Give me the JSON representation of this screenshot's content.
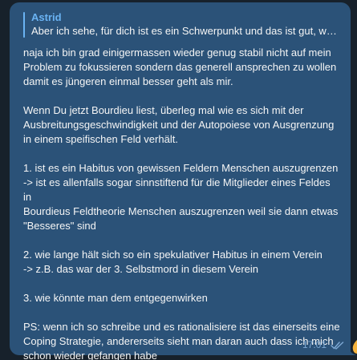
{
  "reply": {
    "author": "Astrid",
    "text": "Aber ich sehe, für dich ist es ein Schwerpunkt und das ist gut, wei..."
  },
  "message": {
    "paragraphs": [
      [
        "naja ich bin grad einigermassen wieder genug stabil nicht auf mein",
        "Problem zu fokussieren sondern das generell ansprechen zu wollen",
        "damit es jüngeren einmal besser geht als mir."
      ],
      [
        "Wenn Du jetzt Bourdieu liest, überleg mal wie es sich mit der",
        "Ausbreitungsgeschwindigkeit und der Autopoiese von Ausgrenzung",
        "in einem speifischen Feld verhält."
      ],
      [
        "1. ist es ein Habitus von gewissen Feldern Menschen auszugrenzen",
        "-> ist es allenfalls sogar sinnstiftend für die Mitglieder eines Feldes in",
        "Bourdieus Feldtheorie Menschen auszugrenzen weil sie dann etwas",
        "\"Besseres\" sind"
      ],
      [
        "2. wie lange hält sich so ein spekulativer Habitus in einem Verein",
        "-> z.B. das war der 3. Selbstmord in diesem Verein"
      ],
      [
        "3. wie könnte man dem entgegenwirken"
      ],
      [
        "PS: wenn ich so schreibe und es rationalisiere ist das einerseits eine",
        "Coping Strategie, andererseits sieht man daran auch dass ich mich",
        "schon wieder gefangen habe"
      ]
    ],
    "time": "17:01",
    "status_icon": "double-check-icon"
  },
  "colors": {
    "background": "#17212b",
    "bubble": "#2b5278",
    "accent": "#6ab3f3",
    "meta": "#7da8d3",
    "side_emoji": "#f6b33c"
  }
}
